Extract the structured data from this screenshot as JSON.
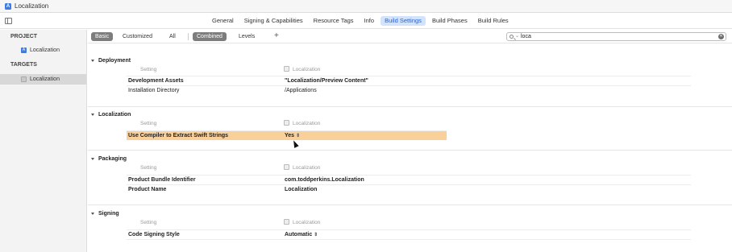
{
  "window": {
    "title": "Localization"
  },
  "tabs": [
    {
      "label": "General",
      "active": false
    },
    {
      "label": "Signing & Capabilities",
      "active": false
    },
    {
      "label": "Resource Tags",
      "active": false
    },
    {
      "label": "Info",
      "active": false
    },
    {
      "label": "Build Settings",
      "active": true
    },
    {
      "label": "Build Phases",
      "active": false
    },
    {
      "label": "Build Rules",
      "active": false
    }
  ],
  "sidebar": {
    "project_heading": "PROJECT",
    "project_item": "Localization",
    "targets_heading": "TARGETS",
    "target_item": "Localization"
  },
  "filter": {
    "basic": "Basic",
    "customized": "Customized",
    "all": "All",
    "combined": "Combined",
    "levels": "Levels",
    "add": "+"
  },
  "search": {
    "value": "loca"
  },
  "sections": [
    {
      "title": "Deployment",
      "col_setting": "Setting",
      "col_target": "Localization",
      "rows": [
        {
          "name": "Development Assets",
          "value": "\"Localization/Preview Content\""
        },
        {
          "name": "Installation Directory",
          "value": "/Applications"
        }
      ]
    },
    {
      "title": "Localization",
      "col_setting": "Setting",
      "col_target": "Localization",
      "rows": [
        {
          "name": "Use Compiler to Extract Swift Strings",
          "value": "Yes"
        }
      ]
    },
    {
      "title": "Packaging",
      "col_setting": "Setting",
      "col_target": "Localization",
      "rows": [
        {
          "name": "Product Bundle Identifier",
          "value": "com.toddperkins.Localization"
        },
        {
          "name": "Product Name",
          "value": "Localization"
        }
      ]
    },
    {
      "title": "Signing",
      "col_setting": "Setting",
      "col_target": "Localization",
      "rows": [
        {
          "name": "Code Signing Style",
          "value": "Automatic"
        }
      ]
    }
  ],
  "colors": {
    "selected_tab_bg": "#d2e3fb",
    "selected_tab_fg": "#2766d0",
    "highlight_row": "#f9cf9a",
    "accent": "#3d7be6"
  }
}
